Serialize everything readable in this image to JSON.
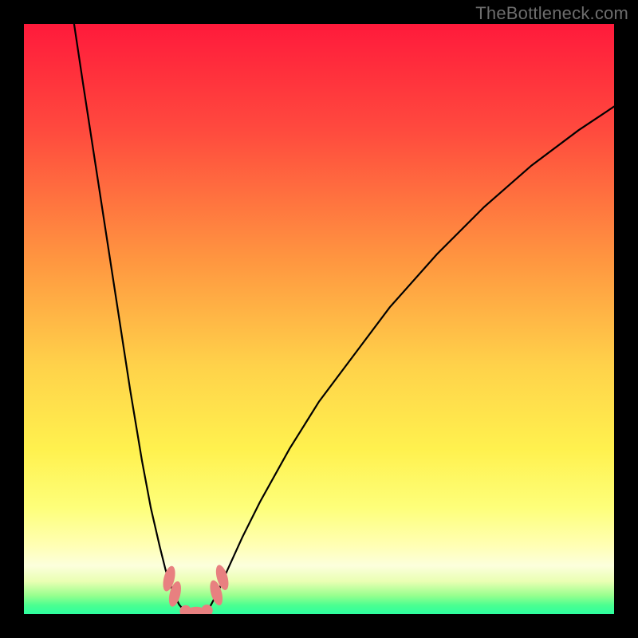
{
  "watermark": "TheBottleneck.com",
  "colors": {
    "background": "#000000",
    "gradient_stops": [
      {
        "offset": 0.0,
        "color": "#ff1a3b"
      },
      {
        "offset": 0.18,
        "color": "#ff4a3e"
      },
      {
        "offset": 0.4,
        "color": "#ff9640"
      },
      {
        "offset": 0.58,
        "color": "#ffd24a"
      },
      {
        "offset": 0.72,
        "color": "#fff14e"
      },
      {
        "offset": 0.82,
        "color": "#feff7a"
      },
      {
        "offset": 0.885,
        "color": "#ffffb5"
      },
      {
        "offset": 0.918,
        "color": "#fcffdc"
      },
      {
        "offset": 0.945,
        "color": "#e9ffb2"
      },
      {
        "offset": 0.968,
        "color": "#9aff8f"
      },
      {
        "offset": 0.985,
        "color": "#4bff90"
      },
      {
        "offset": 1.0,
        "color": "#2dffa0"
      }
    ],
    "curve": "#000000",
    "marker": "#e88080"
  },
  "chart_data": {
    "type": "line",
    "title": "",
    "xlabel": "",
    "ylabel": "",
    "xlim": [
      0,
      100
    ],
    "ylim": [
      0,
      100
    ],
    "grid": false,
    "legend": false,
    "series": [
      {
        "name": "curve-left",
        "x": [
          8.5,
          10,
          12,
          14,
          16,
          18,
          20,
          21.5,
          23,
          24,
          25,
          25.7,
          26.3,
          26.8
        ],
        "values": [
          100,
          90,
          77,
          64,
          51,
          38,
          26,
          18,
          11.5,
          7.5,
          4.5,
          2.8,
          1.6,
          1.0
        ]
      },
      {
        "name": "curve-bottom",
        "x": [
          26.8,
          27.5,
          28.5,
          29.5,
          30.5,
          31.4
        ],
        "values": [
          1.0,
          0.5,
          0.35,
          0.35,
          0.5,
          1.0
        ]
      },
      {
        "name": "curve-right",
        "x": [
          31.4,
          32.2,
          33.2,
          34.5,
          37,
          40,
          45,
          50,
          56,
          62,
          70,
          78,
          86,
          94,
          100
        ],
        "values": [
          1.0,
          2.5,
          4.5,
          7.5,
          13,
          19,
          28,
          36,
          44,
          52,
          61,
          69,
          76,
          82,
          86
        ]
      }
    ],
    "markers": [
      {
        "name": "marker-left-upper",
        "cx": 24.6,
        "cy": 6.0,
        "rx": 0.9,
        "ry": 2.2,
        "rot": 14
      },
      {
        "name": "marker-left-lower",
        "cx": 25.6,
        "cy": 3.4,
        "rx": 0.9,
        "ry": 2.2,
        "rot": 14
      },
      {
        "name": "marker-bottom-1",
        "cx": 27.4,
        "cy": 0.5,
        "rx": 1.0,
        "ry": 1.0,
        "rot": 0
      },
      {
        "name": "marker-bottom-2",
        "cx": 29.2,
        "cy": 0.35,
        "rx": 1.6,
        "ry": 0.9,
        "rot": 0
      },
      {
        "name": "marker-bottom-3",
        "cx": 31.0,
        "cy": 0.6,
        "rx": 1.0,
        "ry": 1.0,
        "rot": 0
      },
      {
        "name": "marker-right-lower",
        "cx": 32.6,
        "cy": 3.6,
        "rx": 0.9,
        "ry": 2.2,
        "rot": -16
      },
      {
        "name": "marker-right-upper",
        "cx": 33.6,
        "cy": 6.2,
        "rx": 0.9,
        "ry": 2.2,
        "rot": -16
      }
    ]
  }
}
